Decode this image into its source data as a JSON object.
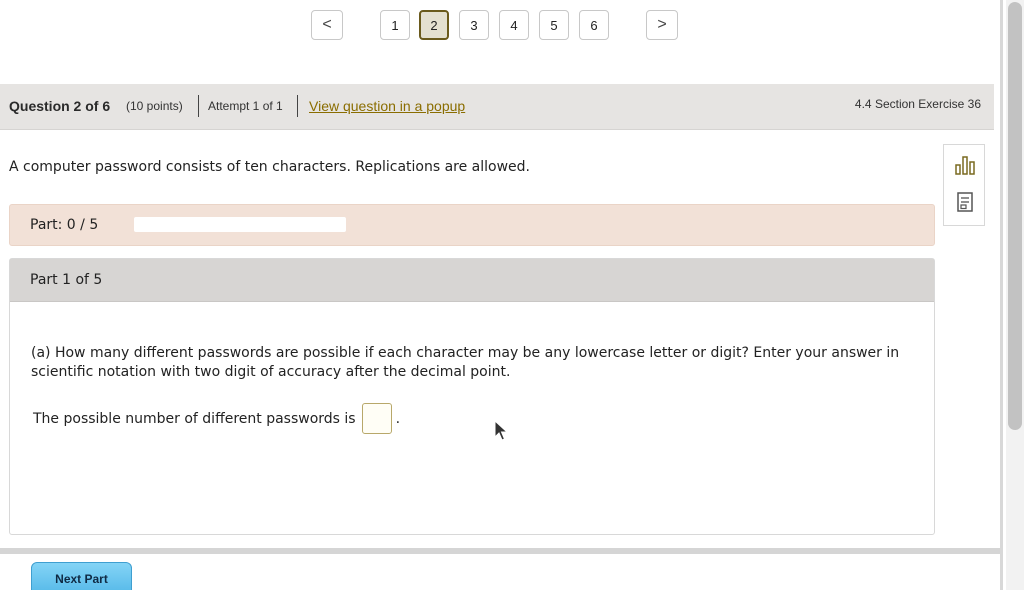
{
  "pagination": {
    "prev": "<",
    "next": ">",
    "pages": [
      "1",
      "2",
      "3",
      "4",
      "5",
      "6"
    ],
    "active_page": "2"
  },
  "header": {
    "question": "Question 2 of 6",
    "points": "(10 points)",
    "attempt": "Attempt 1 of 1",
    "popup_link": "View question in a popup",
    "section": "4.4 Section Exercise 36"
  },
  "statement": "A computer password consists of ten characters. Replications are allowed.",
  "side_tools": {
    "icons": [
      "bar-chart-icon",
      "notes-icon"
    ]
  },
  "progress": {
    "label": "Part: 0 / 5",
    "fraction": 0
  },
  "part": {
    "title": "Part 1 of 5",
    "question": "(a) How many different passwords are possible if each character may be any lowercase letter or digit? Enter your answer in scientific notation with two digit of accuracy after the decimal point.",
    "answer_prefix": "The possible number of different passwords is",
    "answer_value": "",
    "answer_suffix": "."
  },
  "buttons": {
    "next_part": "Next Part"
  },
  "colors": {
    "accent_link": "#8a6d00",
    "progress_band": "#f2e1d7",
    "next_button": "#5ab9e8"
  }
}
